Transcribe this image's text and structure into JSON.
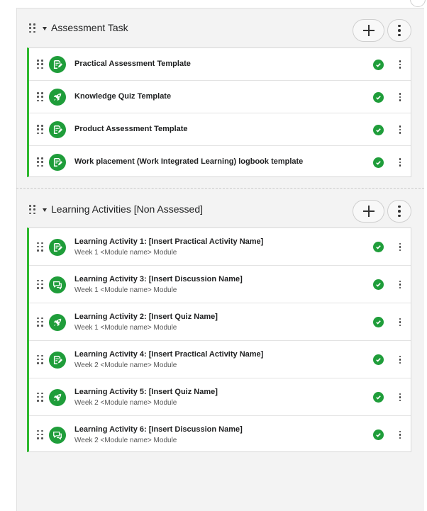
{
  "sections": [
    {
      "title": "Assessment Task",
      "items": [
        {
          "title": "Practical Assessment Template",
          "subtitle": "",
          "icon": "edit-document-icon",
          "status": "complete"
        },
        {
          "title": "Knowledge Quiz Template",
          "subtitle": "",
          "icon": "rocket-icon",
          "status": "complete"
        },
        {
          "title": "Product Assessment Template",
          "subtitle": "",
          "icon": "edit-document-icon",
          "status": "complete"
        },
        {
          "title": "Work placement (Work Integrated Learning) logbook template",
          "subtitle": "",
          "icon": "edit-document-icon",
          "status": "complete"
        }
      ]
    },
    {
      "title": "Learning Activities [Non Assessed]",
      "items": [
        {
          "title": "Learning Activity 1: [Insert Practical Activity Name]",
          "subtitle": "Week 1 <Module name> Module",
          "icon": "edit-document-icon",
          "status": "complete"
        },
        {
          "title": "Learning Activity 3: [Insert Discussion Name]",
          "subtitle": "Week 1 <Module name> Module",
          "icon": "discussion-icon",
          "status": "complete"
        },
        {
          "title": "Learning Activity 2: [Insert Quiz Name]",
          "subtitle": "Week 1 <Module name> Module",
          "icon": "rocket-icon",
          "status": "complete"
        },
        {
          "title": "Learning Activity 4: [Insert Practical Activity Name]",
          "subtitle": "Week 2 <Module name> Module",
          "icon": "edit-document-icon",
          "status": "complete"
        },
        {
          "title": "Learning Activity 5: [Insert Quiz Name]",
          "subtitle": "Week 2 <Module name> Module",
          "icon": "rocket-icon",
          "status": "complete"
        },
        {
          "title": "Learning Activity 6: [Insert Discussion Name]",
          "subtitle": "Week 2 <Module name> Module",
          "icon": "discussion-icon",
          "status": "complete"
        }
      ]
    }
  ],
  "colors": {
    "accent": "#2eb82e",
    "icon_bg": "#1f9d3a",
    "panel_bg": "#f3f3f3"
  }
}
